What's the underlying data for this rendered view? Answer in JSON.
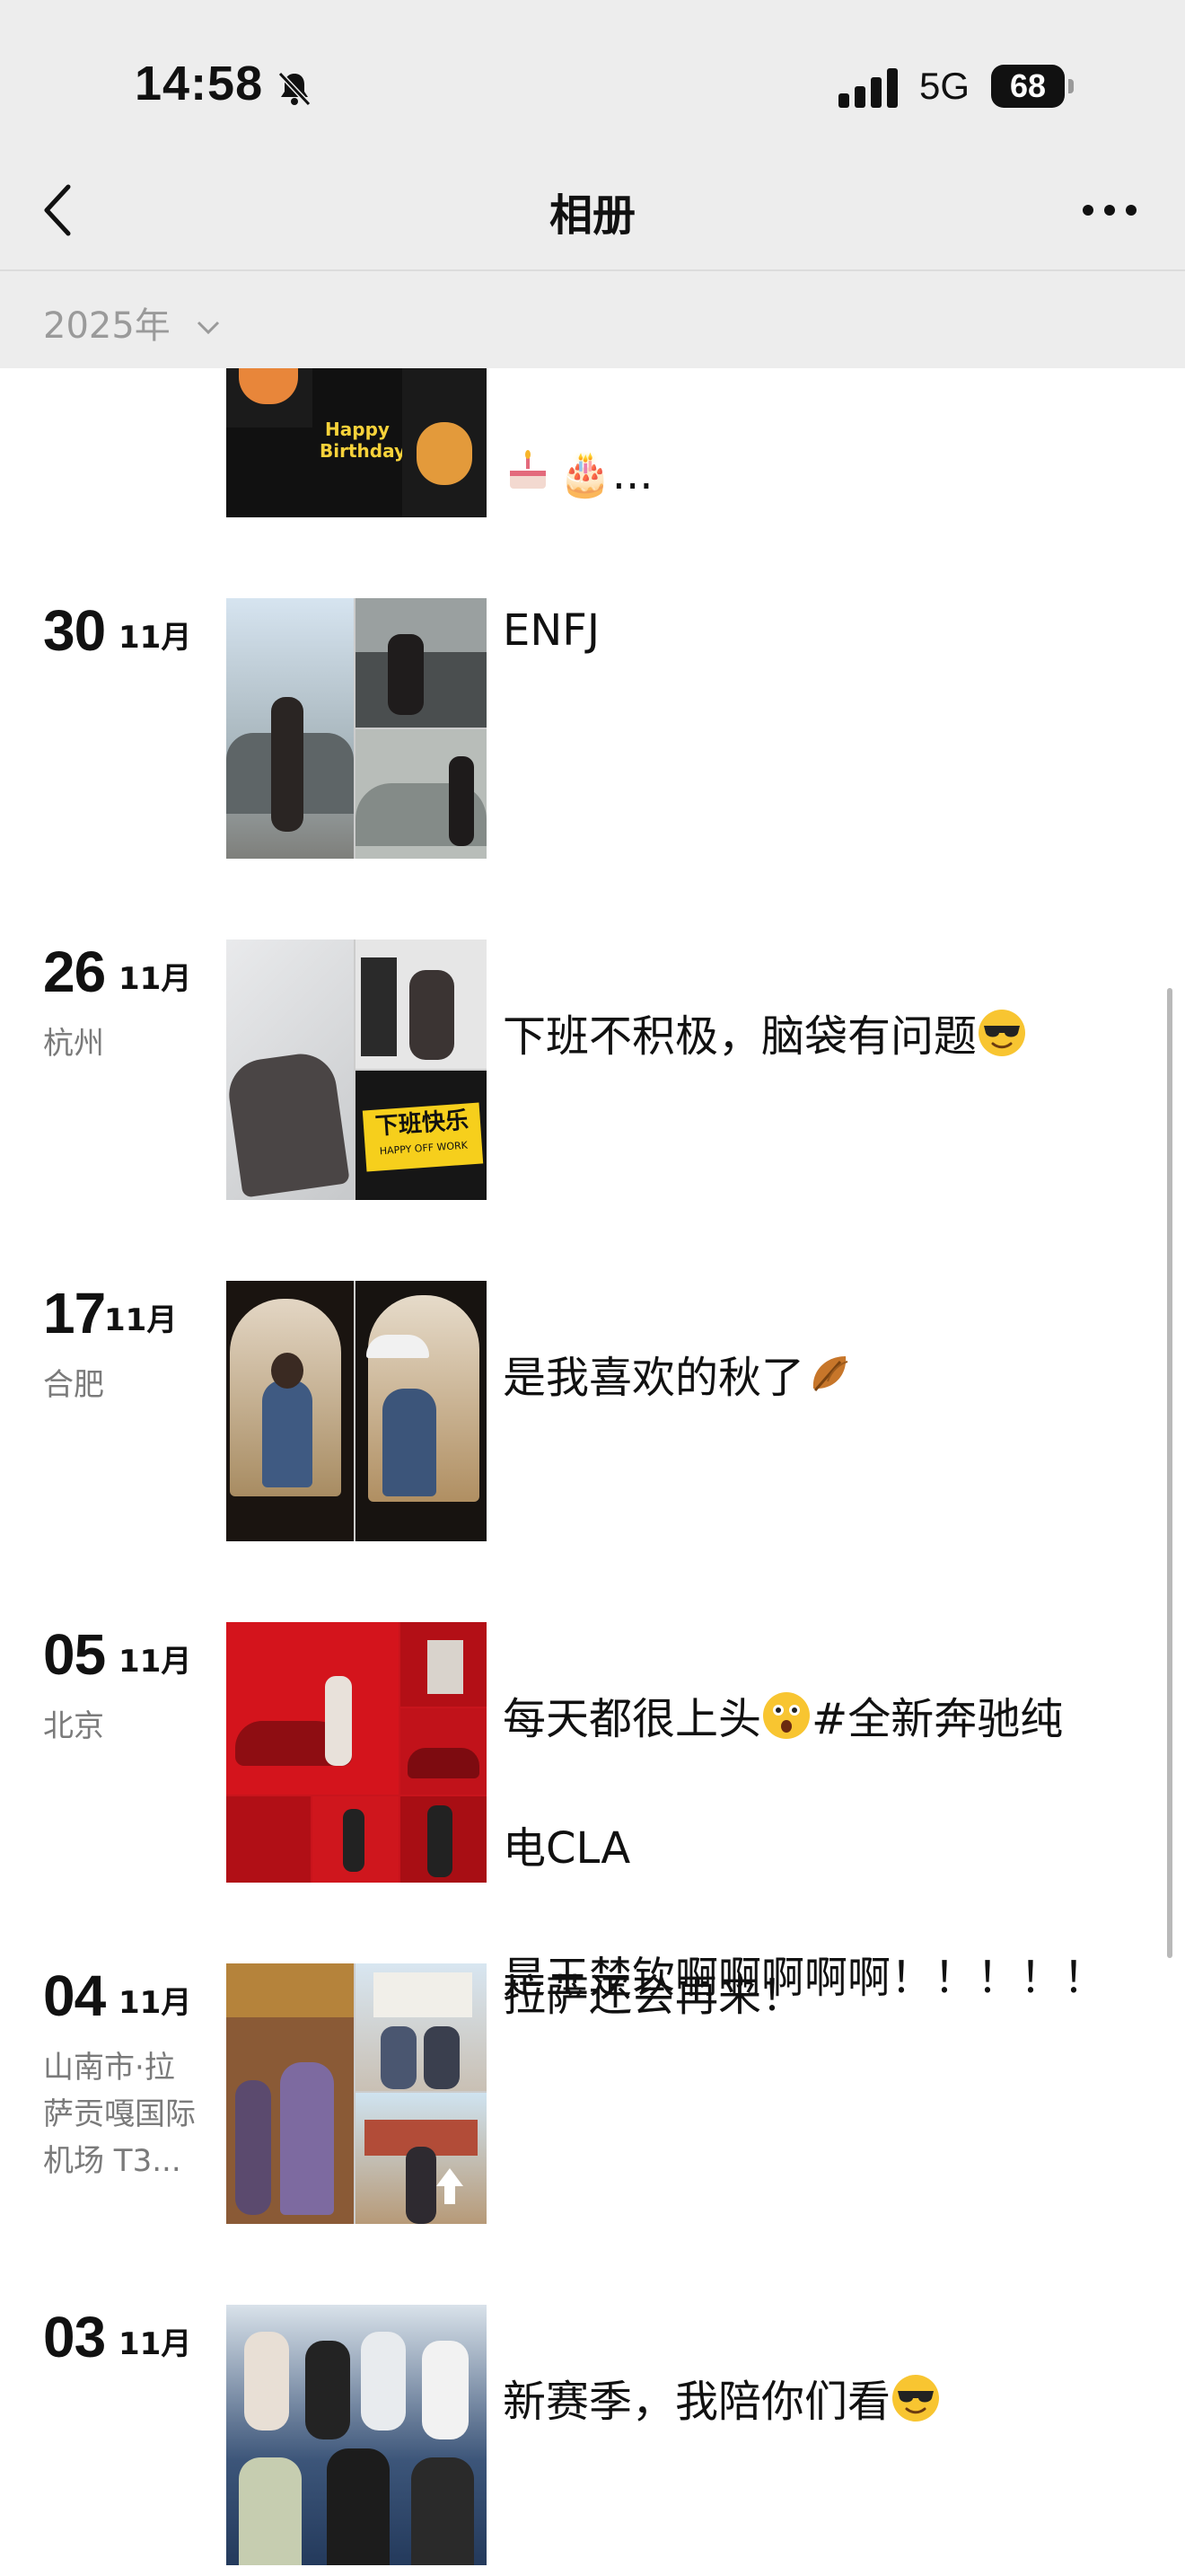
{
  "status_bar": {
    "time": "14:58",
    "network": "5G",
    "battery": "68"
  },
  "nav": {
    "title": "相册"
  },
  "filter": {
    "year": "2025年"
  },
  "first_caption_tail": "🎂...",
  "posts": [
    {
      "day": "30",
      "month": "11月",
      "location": "",
      "caption": "ENFJ"
    },
    {
      "day": "26",
      "month": "11月",
      "location": "杭州",
      "caption": "下班不积极，脑袋有问题"
    },
    {
      "day": "17",
      "month": "11月",
      "location": "合肥",
      "caption": "是我喜欢的秋了"
    },
    {
      "day": "05",
      "month": "11月",
      "location": "北京",
      "caption_lines": [
        "每天都很上头",
        "#全新奔驰纯",
        "电CLA",
        "是王楚钦啊啊啊啊啊！！！！！"
      ]
    },
    {
      "day": "04",
      "month": "11月",
      "location": "山南市·拉萨贡嘎国际机场T3...",
      "location_lines": [
        "山南市·拉",
        "萨贡嘎国际",
        "机场 T3..."
      ],
      "caption": "拉萨还会再来！"
    },
    {
      "day": "03",
      "month": "11月",
      "location": "",
      "caption": "新赛季，我陪你们看"
    }
  ],
  "thumb_texts": {
    "work_sign": "下班快乐",
    "work_sign_sub": "HAPPY OFF WORK",
    "birthday": "Happy Birthday"
  },
  "colors": {
    "background": "#ffffff",
    "header": "#ededed",
    "secondary_text": "#7a7a7a"
  }
}
